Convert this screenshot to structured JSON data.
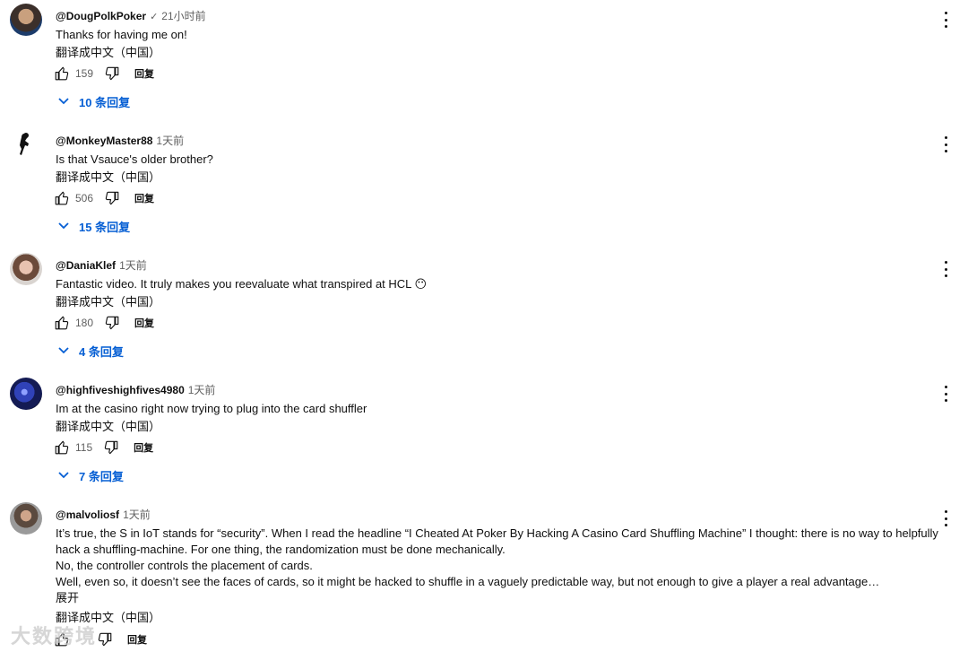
{
  "comments": [
    {
      "author": "@DougPolkPoker",
      "verified_mark": "✓",
      "time": "21小时前",
      "text_lines": [
        "Thanks for having me on!"
      ],
      "translate": "翻译成中文（中国）",
      "likes": "159",
      "reply_label": "回复",
      "replies_label": "10 条回复"
    },
    {
      "author": "@MonkeyMaster88",
      "time": "1天前",
      "text_lines": [
        "Is that Vsauce's older brother?"
      ],
      "translate": "翻译成中文（中国）",
      "likes": "506",
      "reply_label": "回复",
      "replies_label": "15 条回复"
    },
    {
      "author": "@DaniaKlef",
      "time": "1天前",
      "text_lines": [
        "Fantastic video.  It truly makes you reevaluate what transpired at HCL 😶"
      ],
      "translate": "翻译成中文（中国）",
      "likes": "180",
      "reply_label": "回复",
      "replies_label": "4 条回复"
    },
    {
      "author": "@highfiveshighfives4980",
      "time": "1天前",
      "text_lines": [
        "Im at the casino right now trying to plug into the card shuffler"
      ],
      "translate": "翻译成中文（中国）",
      "likes": "115",
      "reply_label": "回复",
      "replies_label": "7 条回复"
    },
    {
      "author": "@malvoliosf",
      "time": "1天前",
      "text_lines": [
        "It’s true, the S in IoT stands for “security”.  When I read the headline “I Cheated At Poker By Hacking A Casino Card Shuffling Machine” I thought: there is no way to helpfully",
        "hack a shuffling-machine.  For one thing, the randomization must be done mechanically.",
        "No, the controller controls the placement of cards.",
        "Well, even so, it doesn’t see the faces of cards, so it might be hacked to shuffle in a vaguely predictable way, but not enough to give a player a real advantage…"
      ],
      "expand": "展开",
      "translate": "翻译成中文（中国）",
      "reply_label": "回复"
    }
  ],
  "watermark": "大数跨境",
  "icons": {
    "like": "thumbs-up-icon",
    "dislike": "thumbs-down-icon",
    "replies_toggle": "chevron-down-icon",
    "menu": "more-vert-icon"
  },
  "colors": {
    "link_blue": "#065fd4",
    "secondary_text": "#606060"
  }
}
